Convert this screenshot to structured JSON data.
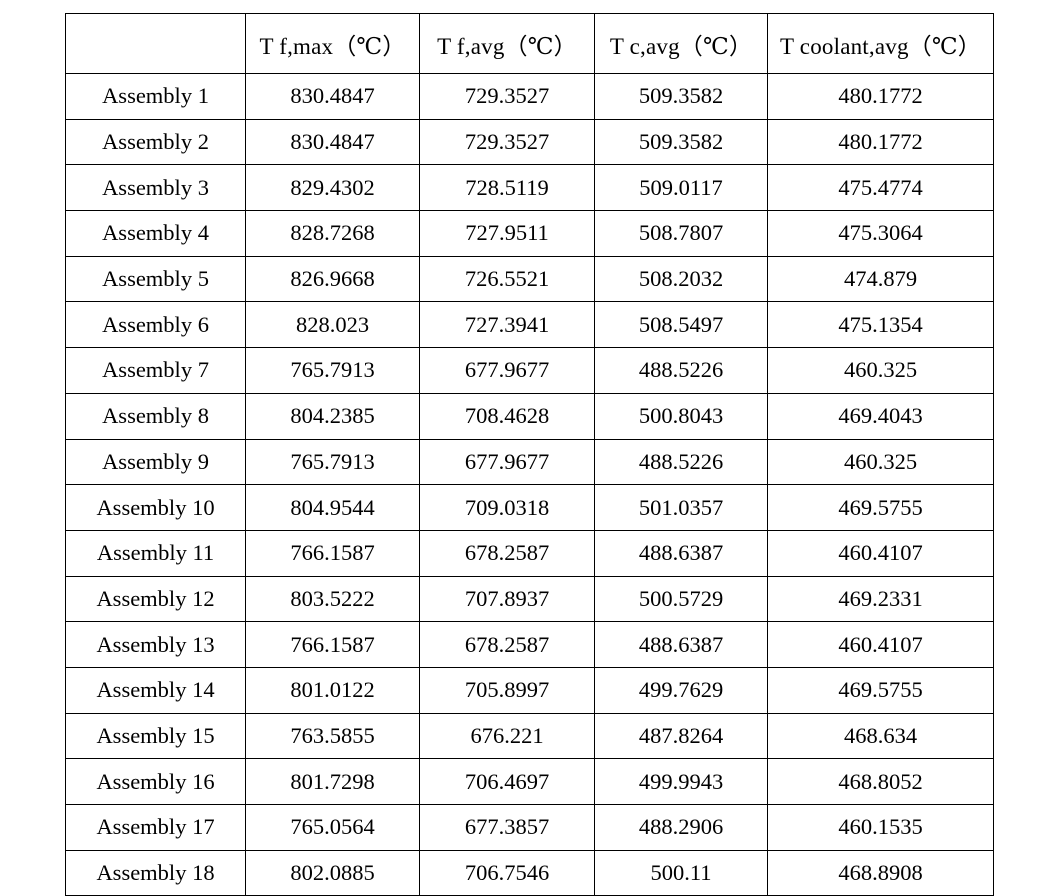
{
  "table": {
    "columns": [
      {
        "key": "assembly",
        "label": ""
      },
      {
        "key": "tfmax",
        "label": "T f,max（℃）"
      },
      {
        "key": "tfavg",
        "label": "T f,avg（℃）"
      },
      {
        "key": "tcavg",
        "label": "T c,avg（℃）"
      },
      {
        "key": "tcoolantavg",
        "label": "T coolant,avg（℃）"
      }
    ],
    "rows": [
      {
        "assembly": "Assembly 1",
        "tfmax": "830.4847",
        "tfavg": "729.3527",
        "tcavg": "509.3582",
        "tcoolantavg": "480.1772"
      },
      {
        "assembly": "Assembly 2",
        "tfmax": "830.4847",
        "tfavg": "729.3527",
        "tcavg": "509.3582",
        "tcoolantavg": "480.1772"
      },
      {
        "assembly": "Assembly 3",
        "tfmax": "829.4302",
        "tfavg": "728.5119",
        "tcavg": "509.0117",
        "tcoolantavg": "475.4774"
      },
      {
        "assembly": "Assembly 4",
        "tfmax": "828.7268",
        "tfavg": "727.9511",
        "tcavg": "508.7807",
        "tcoolantavg": "475.3064"
      },
      {
        "assembly": "Assembly 5",
        "tfmax": "826.9668",
        "tfavg": "726.5521",
        "tcavg": "508.2032",
        "tcoolantavg": "474.879"
      },
      {
        "assembly": "Assembly 6",
        "tfmax": "828.023",
        "tfavg": "727.3941",
        "tcavg": "508.5497",
        "tcoolantavg": "475.1354"
      },
      {
        "assembly": "Assembly 7",
        "tfmax": "765.7913",
        "tfavg": "677.9677",
        "tcavg": "488.5226",
        "tcoolantavg": "460.325"
      },
      {
        "assembly": "Assembly 8",
        "tfmax": "804.2385",
        "tfavg": "708.4628",
        "tcavg": "500.8043",
        "tcoolantavg": "469.4043"
      },
      {
        "assembly": "Assembly 9",
        "tfmax": "765.7913",
        "tfavg": "677.9677",
        "tcavg": "488.5226",
        "tcoolantavg": "460.325"
      },
      {
        "assembly": "Assembly 10",
        "tfmax": "804.9544",
        "tfavg": "709.0318",
        "tcavg": "501.0357",
        "tcoolantavg": "469.5755"
      },
      {
        "assembly": "Assembly 11",
        "tfmax": "766.1587",
        "tfavg": "678.2587",
        "tcavg": "488.6387",
        "tcoolantavg": "460.4107"
      },
      {
        "assembly": "Assembly 12",
        "tfmax": "803.5222",
        "tfavg": "707.8937",
        "tcavg": "500.5729",
        "tcoolantavg": "469.2331"
      },
      {
        "assembly": "Assembly 13",
        "tfmax": "766.1587",
        "tfavg": "678.2587",
        "tcavg": "488.6387",
        "tcoolantavg": "460.4107"
      },
      {
        "assembly": "Assembly 14",
        "tfmax": "801.0122",
        "tfavg": "705.8997",
        "tcavg": "499.7629",
        "tcoolantavg": "469.5755"
      },
      {
        "assembly": "Assembly 15",
        "tfmax": "763.5855",
        "tfavg": "676.221",
        "tcavg": "487.8264",
        "tcoolantavg": "468.634"
      },
      {
        "assembly": "Assembly 16",
        "tfmax": "801.7298",
        "tfavg": "706.4697",
        "tcavg": "499.9943",
        "tcoolantavg": "468.8052"
      },
      {
        "assembly": "Assembly 17",
        "tfmax": "765.0564",
        "tfavg": "677.3857",
        "tcavg": "488.2906",
        "tcoolantavg": "460.1535"
      },
      {
        "assembly": "Assembly 18",
        "tfmax": "802.0885",
        "tfavg": "706.7546",
        "tcavg": "500.11",
        "tcoolantavg": "468.8908"
      }
    ]
  }
}
